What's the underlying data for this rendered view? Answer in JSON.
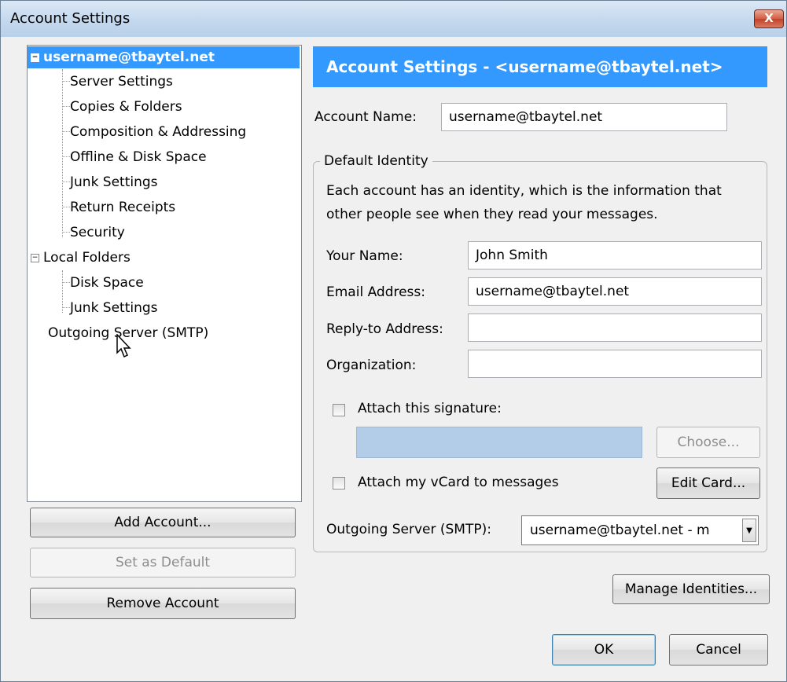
{
  "window": {
    "title": "Account Settings",
    "close_label": "X"
  },
  "tree": {
    "account": "username@tbaytel.net",
    "account_children": [
      "Server Settings",
      "Copies & Folders",
      "Composition & Addressing",
      "Offline & Disk Space",
      "Junk Settings",
      "Return Receipts",
      "Security"
    ],
    "local": "Local Folders",
    "local_children": [
      "Disk Space",
      "Junk Settings"
    ],
    "outgoing": "Outgoing Server (SMTP)"
  },
  "left_buttons": {
    "add": "Add Account...",
    "set_default": "Set as Default",
    "remove": "Remove Account"
  },
  "panel": {
    "header": "Account Settings - <username@tbaytel.net>",
    "account_name_label": "Account Name:",
    "account_name_value": "username@tbaytel.net",
    "group_title": "Default Identity",
    "description_line1": "Each account has an identity, which is the information that",
    "description_line2": "other people see when they read your messages.",
    "your_name_label": "Your Name:",
    "your_name_value": "John Smith",
    "email_label": "Email Address:",
    "email_value": "username@tbaytel.net",
    "reply_label": "Reply-to Address:",
    "reply_value": "",
    "org_label": "Organization:",
    "org_value": "",
    "attach_sig_label": "Attach this signature:",
    "choose_label": "Choose...",
    "attach_vcard_label": "Attach my vCard to messages",
    "edit_card_label": "Edit Card...",
    "smtp_label": "Outgoing Server (SMTP):",
    "smtp_value": "username@tbaytel.net - m",
    "manage_label": "Manage Identities...",
    "ok_label": "OK",
    "cancel_label": "Cancel"
  }
}
